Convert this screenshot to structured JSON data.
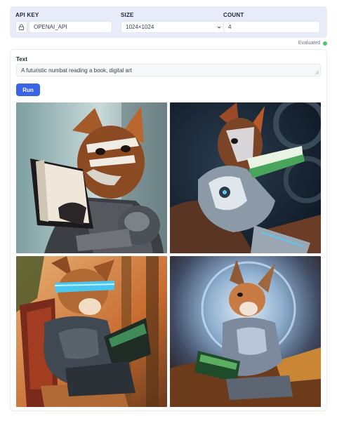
{
  "config": {
    "api_key_label": "API KEY",
    "api_key_value": "OPENAI_API",
    "size_label": "SIZE",
    "size_value": "1024×1024",
    "count_label": "COUNT",
    "count_value": "4"
  },
  "status": {
    "text": "Evaluated",
    "color": "#4cc46a"
  },
  "prompt": {
    "label": "Text",
    "value": "A futuristic numbat reading a book, digital art"
  },
  "run_button": {
    "label": "Run",
    "color": "#3b63e8"
  },
  "images": [
    {
      "icon": "generated-image-numbat-armor"
    },
    {
      "icon": "generated-image-numbat-robot"
    },
    {
      "icon": "generated-image-numbat-visor"
    },
    {
      "icon": "generated-image-numbat-glow"
    }
  ]
}
